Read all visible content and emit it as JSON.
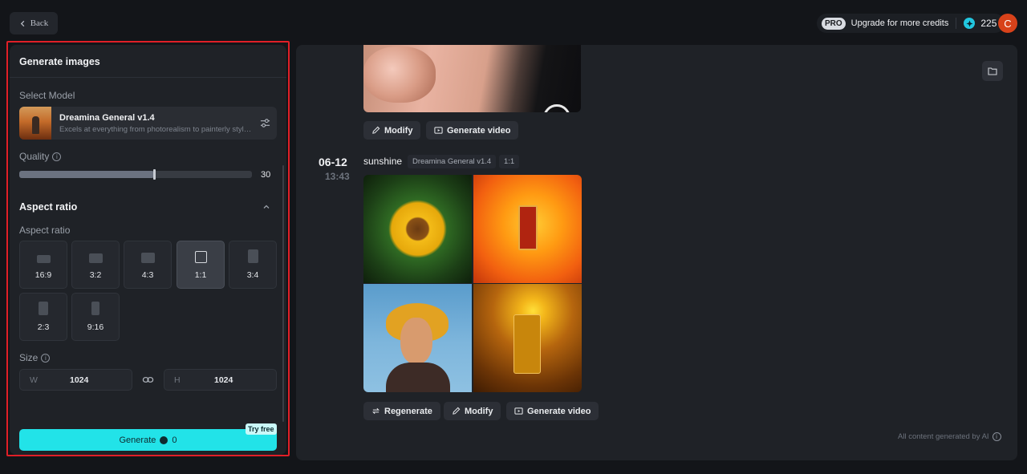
{
  "header": {
    "back_label": "Back",
    "pro_label": "PRO",
    "upgrade_label": "Upgrade for more credits",
    "credits": "225",
    "avatar_initial": "C"
  },
  "sidebar": {
    "title": "Generate images",
    "select_model_label": "Select Model",
    "model": {
      "name": "Dreamina General v1.4",
      "description": "Excels at everything from photorealism to painterly style..."
    },
    "quality_label": "Quality",
    "quality_value": "30",
    "quality_fraction": 0.58,
    "aspect_section_title": "Aspect ratio",
    "aspect_label": "Aspect ratio",
    "aspect_ratios": [
      "16:9",
      "3:2",
      "4:3",
      "1:1",
      "3:4",
      "2:3",
      "9:16"
    ],
    "selected_ratio": "1:1",
    "size_label": "Size",
    "width_prefix": "W",
    "width_value": "1024",
    "height_prefix": "H",
    "height_value": "1024",
    "generate_label": "Generate",
    "generate_cost": "0",
    "try_free_label": "Try free"
  },
  "main": {
    "top_actions": [
      "Modify",
      "Generate video"
    ],
    "entry": {
      "date": "06-12",
      "time": "13:43",
      "prompt": "sunshine",
      "model_tag": "Dreamina General v1.4",
      "ratio_tag": "1:1"
    },
    "entry_actions": [
      "Regenerate",
      "Modify",
      "Generate video"
    ],
    "footer_note": "All content generated by AI"
  },
  "colors": {
    "accent": "#22e3e8",
    "highlight_frame": "#e01f27",
    "avatar": "#d8421a"
  }
}
